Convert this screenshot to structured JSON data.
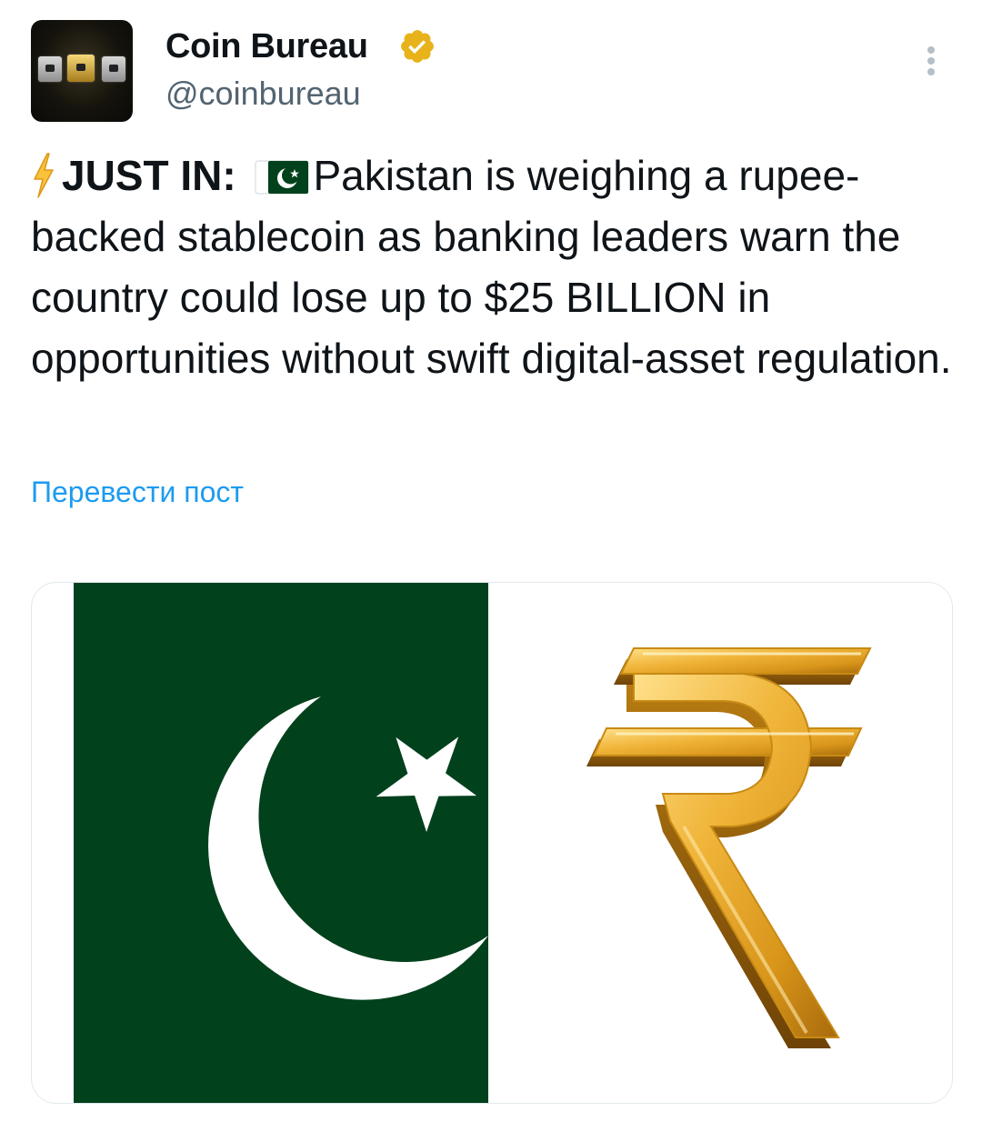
{
  "account": {
    "name": "Coin Bureau",
    "handle": "@coinbureau",
    "verified_color": "#e8b21b"
  },
  "tweet": {
    "emoji_bolt": "lightning-icon",
    "lead": "JUST IN:",
    "emoji_flag": "pakistan-flag-icon",
    "body": "Pakistan is weighing a rupee-backed stablecoin as banking leaders warn the country could lose up to $25 BILLION in opportunities without swift digital-asset regulation."
  },
  "translate_label": "Перевести пост",
  "media": {
    "left_image": "pakistan-flag",
    "right_image": "gold-rupee-symbol",
    "flag_green": "#01411c",
    "gold": "#d9a21c"
  },
  "colors": {
    "link": "#1d9bf0",
    "secondary_text": "#536471"
  }
}
